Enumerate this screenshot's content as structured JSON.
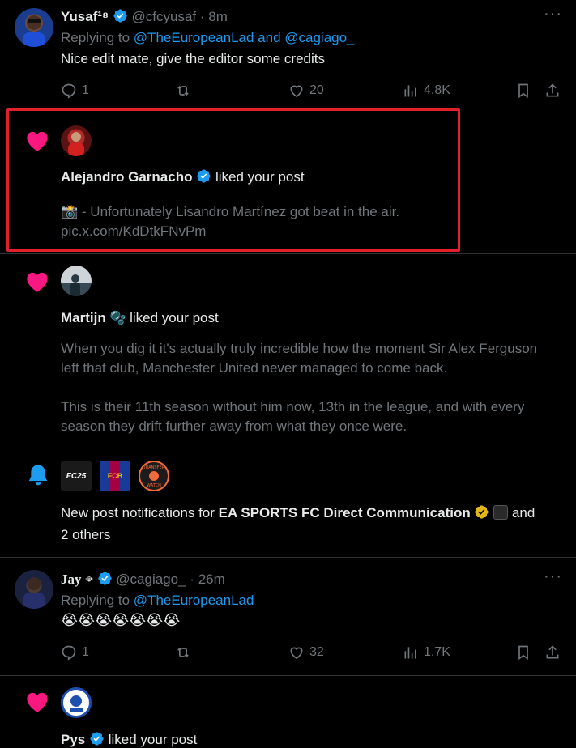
{
  "reply1": {
    "name": "Yusaf¹⁸",
    "handle": "@cfcyusaf",
    "time": "8m",
    "replying_prefix": "Replying to",
    "replying_to": "@TheEuropeanLad and @cagiago_",
    "text": "Nice edit mate, give the editor some credits",
    "replies": "1",
    "likes": "20",
    "views": "4.8K"
  },
  "like1": {
    "name": "Alejandro Garnacho",
    "action": "liked your post",
    "emoji": "📸",
    "text": "- Unfortunately Lisandro Martínez got beat in the air.",
    "link": "pic.x.com/KdDtkFNvPm"
  },
  "like2": {
    "name": "Martijn",
    "emoji": "🫧",
    "action": "liked your post",
    "para1": "When you dig it it's actually truly incredible how the moment Sir Alex Ferguson left that club, Manchester United never managed to come back.",
    "para2": "This is their 11th season without him now, 13th in the league, and with every season they drift further away from what they once were."
  },
  "notif": {
    "prefix": "New post notifications for",
    "account": "EA SPORTS FC Direct Communication",
    "suffix": "and",
    "others": "2 others",
    "logos": [
      "FC25",
      "FCB",
      "TRANSFER WATCH"
    ]
  },
  "reply2": {
    "name": "Jay",
    "name_symbol": "⌖",
    "handle": "@cagiago_",
    "time": "26m",
    "replying_prefix": "Replying to",
    "replying_to": "@TheEuropeanLad",
    "emojis": "😭😭😭😭😭😭😭",
    "replies": "1",
    "likes": "32",
    "views": "1.7K"
  },
  "like3": {
    "name": "Pys",
    "action": "liked your post"
  },
  "colors": {
    "accent": "#1d9bf0",
    "heart": "#f91880",
    "highlight": "#e0212a",
    "verified_gold": "#e2b719"
  }
}
